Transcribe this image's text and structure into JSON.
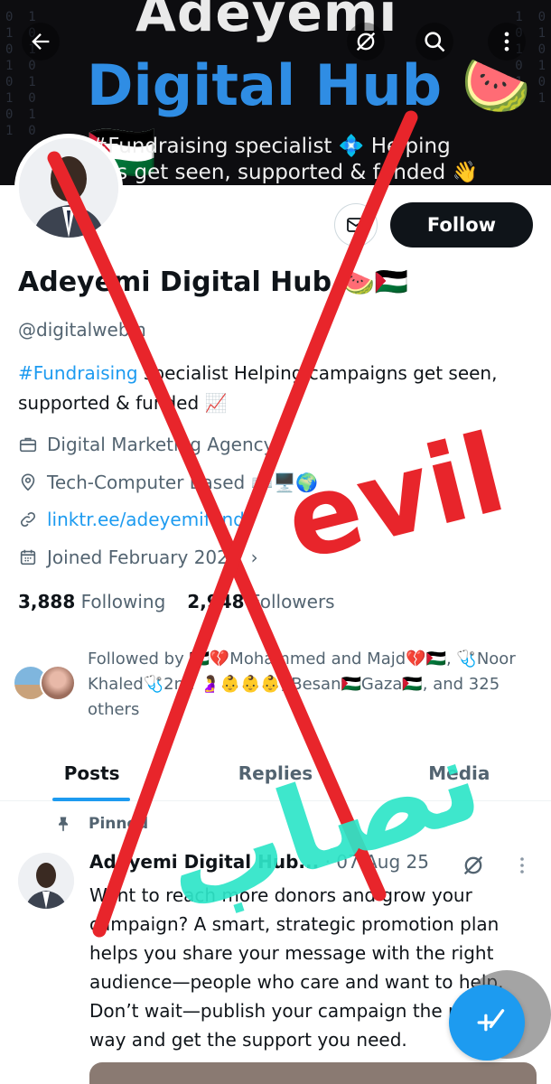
{
  "banner": {
    "title_line1": "Adeyemi",
    "title_line2": "Digital Hub 🍉🇵🇸",
    "tagline_line1": "#Fundraising specialist 💠 Helping",
    "tagline_line2": "gns get seen, supported & funded 👋"
  },
  "topbar": {
    "back_icon": "arrow-left-icon",
    "grok_icon": "grok-icon",
    "search_icon": "search-icon",
    "more_icon": "more-vertical-icon"
  },
  "profile": {
    "name": "Adeyemi Digital Hub 🍉🇵🇸",
    "handle": "@digitalwebin",
    "bio_hashtag": "#Fundraising",
    "bio_rest": " specialist  Helping campaigns get seen, supported & funded 📈",
    "follow_label": "Follow",
    "category": "Digital Marketing Agency",
    "location": "Tech-Computer Based ⌨️🖥️🌍",
    "website": "linktr.ee/adeyemifund",
    "joined": "Joined February 2025",
    "following_count": "3,888",
    "following_label": "Following",
    "followers_count": "2,948",
    "followers_label": "Followers",
    "followed_by": "Followed by 🇵🇸💔Mohammed and Majd💔🇵🇸, 🩺Noor Khaled🩺2nd 🤰👶👶👶, Besan🇵🇸Gaza🇵🇸, and 325 others"
  },
  "tabs": [
    {
      "label": "Posts"
    },
    {
      "label": "Replies"
    },
    {
      "label": "Media"
    }
  ],
  "post": {
    "pinned_label": "Pinned",
    "author": "Adeyemi Digital Hub...",
    "separator": " · ",
    "date": "07 Aug 25",
    "text": "Want to reach more donors and grow your campaign? A smart, strategic promotion plan helps you share your message with the right audience—people who care and want to help. Don’t wait—publish your campaign the right way and get the support you need."
  },
  "overlay": {
    "red_word": "evil",
    "cyan_word": "نصاب"
  },
  "colors": {
    "accent": "#1d9bf0",
    "banner_title2": "#2f8de4",
    "overlay_red": "#e8252b",
    "overlay_cyan": "#2ee6c8"
  }
}
